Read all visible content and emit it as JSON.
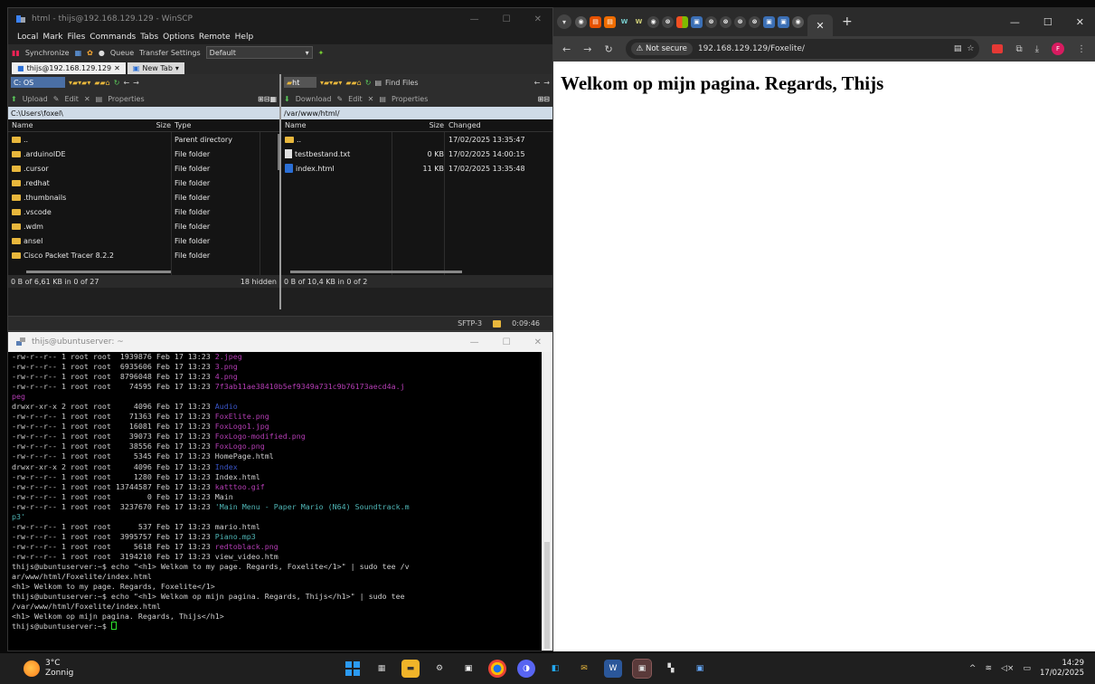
{
  "winscp": {
    "title": "html - thijs@192.168.129.129 - WinSCP",
    "menu": [
      "Local",
      "Mark",
      "Files",
      "Commands",
      "Tabs",
      "Options",
      "Remote",
      "Help"
    ],
    "toolbar": {
      "synchronize": "Synchronize",
      "queue": "Queue",
      "transfer_settings": "Transfer Settings",
      "transfer_value": "Default"
    },
    "tabs": [
      "thijs@192.168.129.129",
      "New Tab"
    ],
    "left": {
      "drive": "C: OS",
      "upload": "Upload",
      "edit": "Edit",
      "properties": "Properties",
      "path": "C:\\Users\\foxel\\",
      "columns": [
        "Name",
        "Size",
        "Type"
      ],
      "files": [
        {
          "name": "..",
          "size": "",
          "type": "Parent directory",
          "kind": "up"
        },
        {
          "name": ".arduinoIDE",
          "size": "",
          "type": "File folder",
          "kind": "folder"
        },
        {
          "name": ".cursor",
          "size": "",
          "type": "File folder",
          "kind": "folder"
        },
        {
          "name": ".redhat",
          "size": "",
          "type": "File folder",
          "kind": "folder"
        },
        {
          "name": ".thumbnails",
          "size": "",
          "type": "File folder",
          "kind": "folder"
        },
        {
          "name": ".vscode",
          "size": "",
          "type": "File folder",
          "kind": "folder"
        },
        {
          "name": ".wdm",
          "size": "",
          "type": "File folder",
          "kind": "folder"
        },
        {
          "name": "ansel",
          "size": "",
          "type": "File folder",
          "kind": "folder"
        },
        {
          "name": "Cisco Packet Tracer 8.2.2",
          "size": "",
          "type": "File folder",
          "kind": "folder"
        }
      ],
      "status": "0 B of 6,61 KB in 0 of 27",
      "hidden": "18 hidden"
    },
    "right": {
      "dir": "ht",
      "find_files": "Find Files",
      "download": "Download",
      "edit": "Edit",
      "properties": "Properties",
      "path": "/var/www/html/",
      "columns": [
        "Name",
        "Size",
        "Changed"
      ],
      "files": [
        {
          "name": "..",
          "size": "",
          "changed": "17/02/2025 13:35:47",
          "kind": "up"
        },
        {
          "name": "testbestand.txt",
          "size": "0 KB",
          "changed": "17/02/2025 14:00:15",
          "kind": "file"
        },
        {
          "name": "index.html",
          "size": "11 KB",
          "changed": "17/02/2025 13:35:48",
          "kind": "html"
        }
      ],
      "status": "0 B of 10,4 KB in 0 of 2"
    },
    "statusbar": {
      "protocol": "SFTP-3",
      "time": "0:09:46"
    }
  },
  "terminal": {
    "title": "thijs@ubuntuserver: ~",
    "lines": [
      [
        {
          "t": "-rw-r--r-- 1 root root  1939876 Feb 17 13:23 "
        },
        {
          "t": "2.jpeg",
          "c": "mag"
        }
      ],
      [
        {
          "t": "-rw-r--r-- 1 root root  6935606 Feb 17 13:23 "
        },
        {
          "t": "3.png",
          "c": "mag"
        }
      ],
      [
        {
          "t": "-rw-r--r-- 1 root root  8796048 Feb 17 13:23 "
        },
        {
          "t": "4.png",
          "c": "mag"
        }
      ],
      [
        {
          "t": "-rw-r--r-- 1 root root    74595 Feb 17 13:23 "
        },
        {
          "t": "7f3ab11ae38410b5ef9349a731c9b76173aecd4a.j",
          "c": "mag"
        }
      ],
      [
        {
          "t": "peg",
          "c": "mag"
        }
      ],
      [
        {
          "t": "drwxr-xr-x 2 root root     4096 Feb 17 13:23 "
        },
        {
          "t": "Audio",
          "c": "blu"
        }
      ],
      [
        {
          "t": "-rw-r--r-- 1 root root    71363 Feb 17 13:23 "
        },
        {
          "t": "FoxElite.png",
          "c": "mag"
        }
      ],
      [
        {
          "t": "-rw-r--r-- 1 root root    16081 Feb 17 13:23 "
        },
        {
          "t": "FoxLogo1.jpg",
          "c": "mag"
        }
      ],
      [
        {
          "t": "-rw-r--r-- 1 root root    39073 Feb 17 13:23 "
        },
        {
          "t": "FoxLogo-modified.png",
          "c": "mag"
        }
      ],
      [
        {
          "t": "-rw-r--r-- 1 root root    38556 Feb 17 13:23 "
        },
        {
          "t": "FoxLogo.png",
          "c": "mag"
        }
      ],
      [
        {
          "t": "-rw-r--r-- 1 root root     5345 Feb 17 13:23 HomePage.html"
        }
      ],
      [
        {
          "t": "drwxr-xr-x 2 root root     4096 Feb 17 13:23 "
        },
        {
          "t": "Index",
          "c": "blu"
        }
      ],
      [
        {
          "t": "-rw-r--r-- 1 root root     1280 Feb 17 13:23 Index.html"
        }
      ],
      [
        {
          "t": "-rw-r--r-- 1 root root 13744587 Feb 17 13:23 "
        },
        {
          "t": "katttoo.gif",
          "c": "mag"
        }
      ],
      [
        {
          "t": "-rw-r--r-- 1 root root        0 Feb 17 13:23 Main"
        }
      ],
      [
        {
          "t": "-rw-r--r-- 1 root root  3237670 Feb 17 13:23 "
        },
        {
          "t": "'Main Menu - Paper Mario (N64) Soundtrack.m",
          "c": "cya"
        }
      ],
      [
        {
          "t": "p3'",
          "c": "cya"
        }
      ],
      [
        {
          "t": "-rw-r--r-- 1 root root      537 Feb 17 13:23 mario.html"
        }
      ],
      [
        {
          "t": "-rw-r--r-- 1 root root  3995757 Feb 17 13:23 "
        },
        {
          "t": "Piano.mp3",
          "c": "cya"
        }
      ],
      [
        {
          "t": "-rw-r--r-- 1 root root     5618 Feb 17 13:23 "
        },
        {
          "t": "redtoblack.png",
          "c": "mag"
        }
      ],
      [
        {
          "t": "-rw-r--r-- 1 root root  3194210 Feb 17 13:23 view_video.htm"
        }
      ],
      [
        {
          "t": "thijs@ubuntuserver:~$ echo \"<h1> Welkom to my page. Regards, Foxelite</1>\" | sudo tee /v"
        }
      ],
      [
        {
          "t": "ar/www/html/Foxelite/index.html"
        }
      ],
      [
        {
          "t": "<h1> Welkom to my page. Regards, Foxelite</1>"
        }
      ],
      [
        {
          "t": "thijs@ubuntuserver:~$ echo \"<h1> Welkom op mijn pagina. Regards, Thijs</h1>\" | sudo tee"
        }
      ],
      [
        {
          "t": "/var/www/html/Foxelite/index.html"
        }
      ],
      [
        {
          "t": "<h1> Welkom op mijn pagina. Regards, Thijs</h1>"
        }
      ],
      [
        {
          "t": "thijs@ubuntuserver:~$ "
        }
      ]
    ]
  },
  "browser": {
    "not_secure": "Not secure",
    "url": "192.168.129.129/Foxelite/",
    "profile_initial": "F",
    "heading": "Welkom op mijn pagina. Regards, Thijs"
  },
  "taskbar": {
    "temperature": "3°C",
    "weather": "Zonnig",
    "time": "14:29",
    "date": "17/02/2025"
  }
}
